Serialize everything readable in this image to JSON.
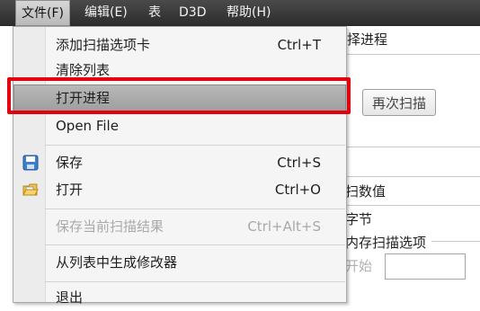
{
  "menubar": {
    "items": [
      {
        "label": "文件(F)"
      },
      {
        "label": "编辑(E)"
      },
      {
        "label": "表"
      },
      {
        "label": "D3D"
      },
      {
        "label": "帮助(H)"
      }
    ]
  },
  "file_menu": {
    "items": [
      {
        "label": "添加扫描选项卡",
        "shortcut": "Ctrl+T"
      },
      {
        "label": "清除列表"
      },
      {
        "label": "打开进程",
        "highlighted": true
      },
      {
        "label": "Open File"
      },
      {
        "label": "保存",
        "shortcut": "Ctrl+S",
        "icon": "save-icon"
      },
      {
        "label": "打开",
        "shortcut": "Ctrl+O",
        "icon": "open-folder-icon"
      },
      {
        "label": "保存当前扫描结果",
        "shortcut": "Ctrl+Alt+S",
        "disabled": true
      },
      {
        "label": "从列表中生成修改器"
      },
      {
        "label": "退出"
      }
    ]
  },
  "background_window": {
    "title_fragment": "择进程",
    "rescan_button": "再次扫描",
    "scan_value_fragment": "扫数值",
    "bytes_fragment": "字节",
    "memory_scan_options_fragment": "内存扫描选项",
    "start_fragment": "开始"
  },
  "highlight_color": "#e2000f"
}
